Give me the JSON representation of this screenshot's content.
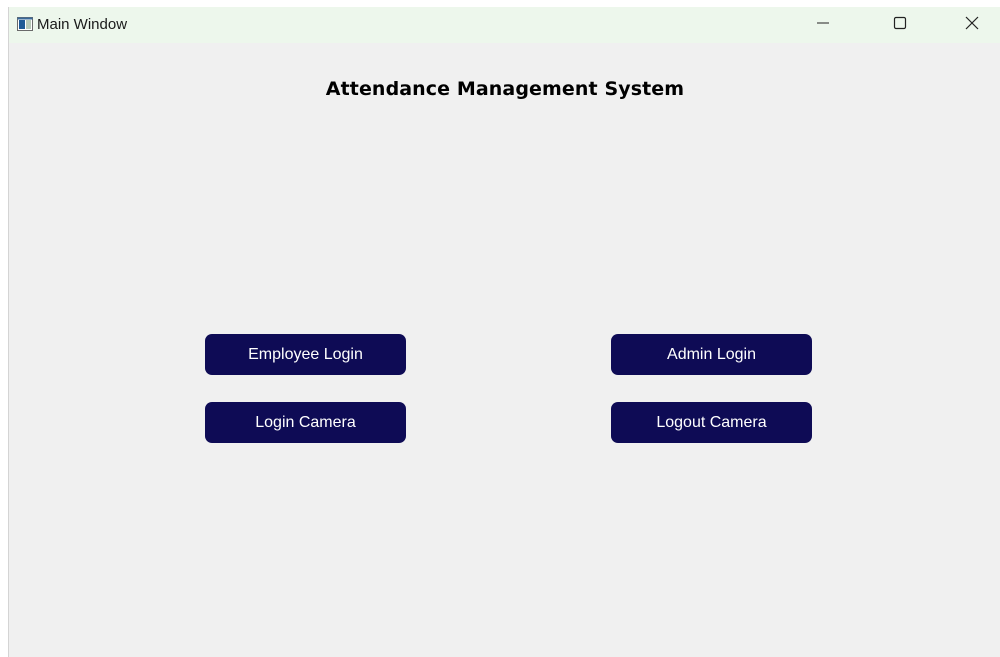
{
  "window": {
    "title": "Main Window",
    "icon": "window-app-icon"
  },
  "controls": {
    "minimize_icon": "minimize-icon",
    "maximize_icon": "maximize-icon",
    "close_icon": "close-icon"
  },
  "main": {
    "heading": "Attendance Management System",
    "buttons": {
      "employee_login": "Employee Login",
      "admin_login": "Admin Login",
      "login_camera": "Login Camera",
      "logout_camera": "Logout Camera"
    }
  },
  "colors": {
    "button_bg": "#0e0b55",
    "button_text": "#ffffff",
    "window_bg": "#f0f0f0",
    "titlebar_bg": "#edf7ec"
  }
}
